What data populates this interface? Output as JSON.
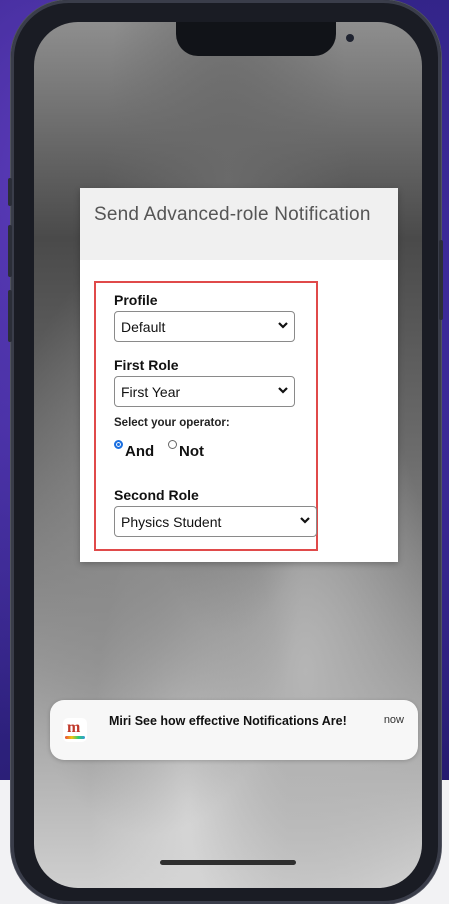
{
  "form": {
    "title": "Send Advanced-role Notification",
    "profile_label": "Profile",
    "profile_value": "Default",
    "first_role_label": "First Role",
    "first_role_value": "First Year",
    "operator_label": "Select your operator:",
    "operator_options": [
      {
        "label": "And",
        "selected": true
      },
      {
        "label": "Not",
        "selected": false
      }
    ],
    "second_role_label": "Second Role",
    "second_role_value": "Physics Student"
  },
  "notification": {
    "app_icon": "m-logo-icon",
    "text": "Miri See how effective Notifications Are!",
    "time": "now"
  },
  "colors": {
    "highlight_border": "#e04a4a",
    "radio_selected": "#1a6fe0",
    "background_purple": "#3b2a96"
  }
}
